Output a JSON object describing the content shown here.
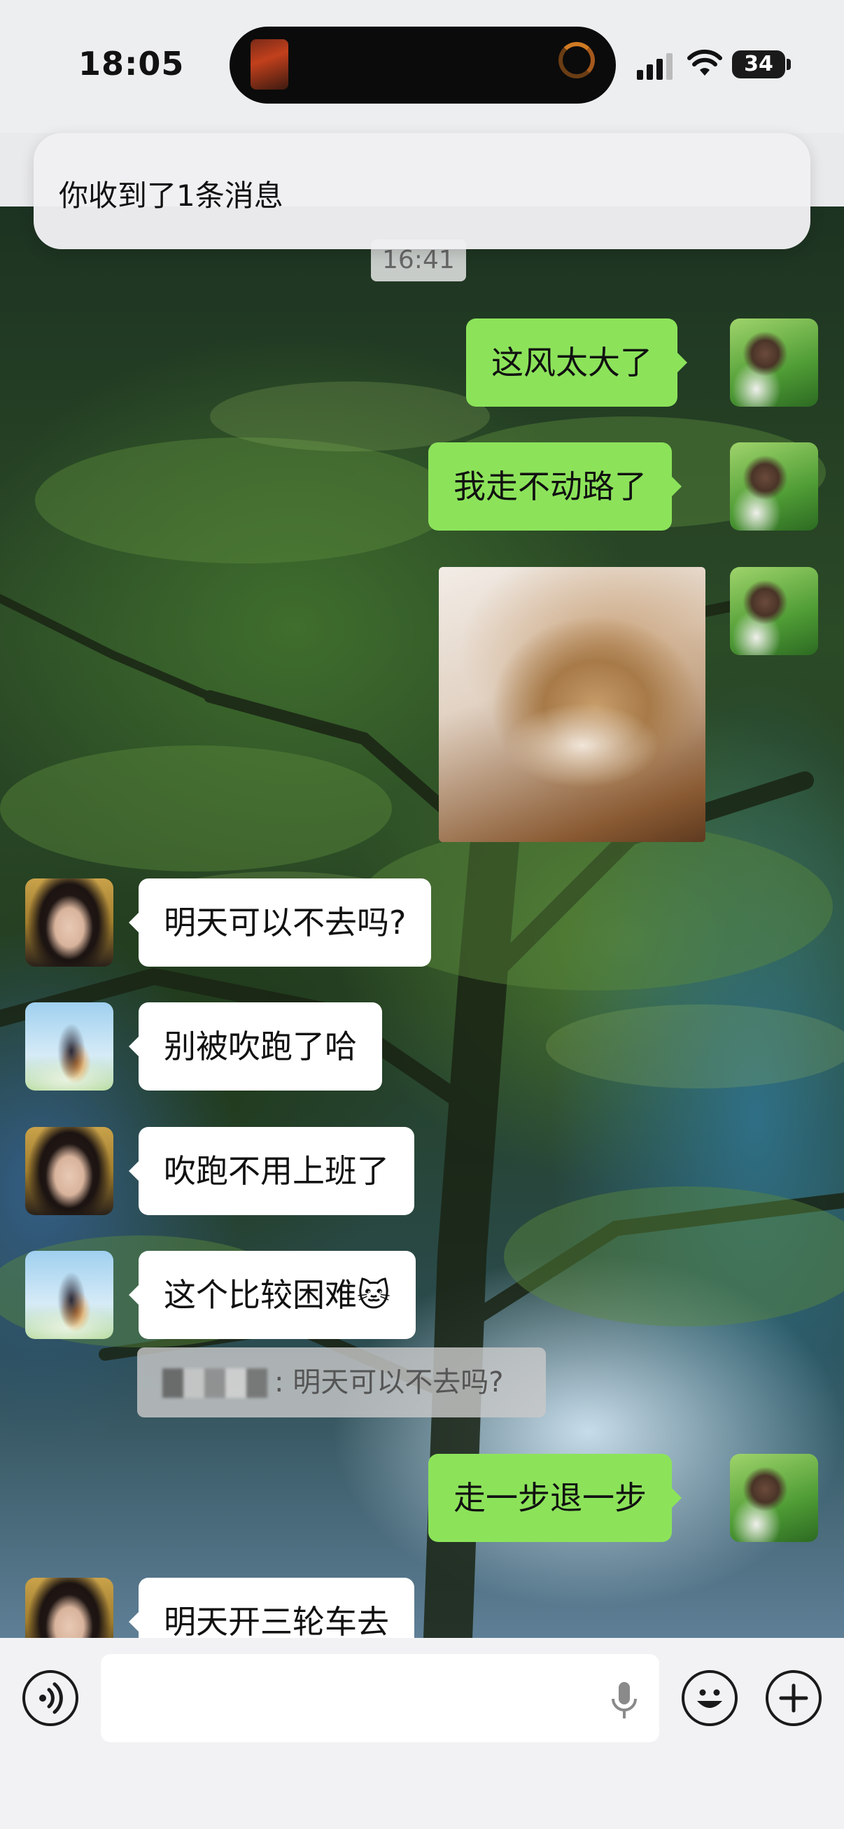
{
  "status_bar": {
    "time": "18:05",
    "battery": "34",
    "icons": [
      "cellular-signal-icon",
      "wifi-icon",
      "battery-icon"
    ]
  },
  "notification": {
    "text": "你收到了1条消息"
  },
  "chat": {
    "timestamp": "16:41",
    "messages": [
      {
        "side": "mine",
        "text": "这风太大了"
      },
      {
        "side": "mine",
        "text": "我走不动路了"
      },
      {
        "side": "mine",
        "type": "image",
        "description": "sticker"
      },
      {
        "side": "theirs",
        "sender": "girl",
        "text": "明天可以不去吗?"
      },
      {
        "side": "theirs",
        "sender": "kid",
        "text": "别被吹跑了哈"
      },
      {
        "side": "theirs",
        "sender": "girl",
        "text": "吹跑不用上班了"
      },
      {
        "side": "theirs",
        "sender": "kid",
        "text": "这个比较困难",
        "emoji": "🐱"
      },
      {
        "side": "mine",
        "text": "走一步退一步"
      },
      {
        "side": "theirs",
        "sender": "girl",
        "text": "明天开三轮车去"
      }
    ],
    "quote": {
      "text": ": 明天可以不去吗?"
    }
  },
  "input_bar": {
    "icons": [
      "voice-toggle-icon",
      "mic-icon",
      "emoji-icon",
      "plus-icon"
    ]
  }
}
